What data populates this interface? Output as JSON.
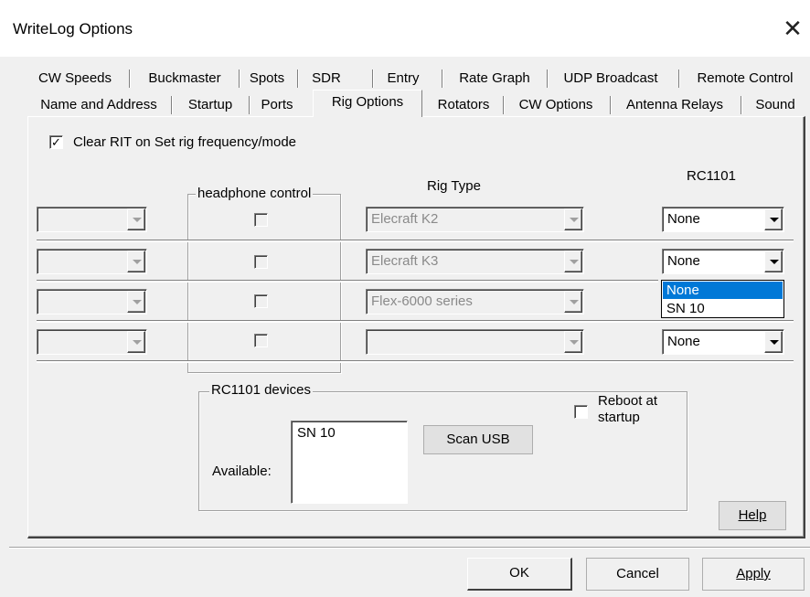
{
  "window": {
    "title": "WriteLog Options",
    "close_glyph": "✕"
  },
  "tabs_row1": [
    "CW Speeds",
    "Buckmaster",
    "Spots",
    "SDR",
    "Entry",
    "Rate Graph",
    "UDP Broadcast",
    "Remote Control"
  ],
  "tabs_row2": [
    "Name and Address",
    "Startup",
    "Ports",
    "Rig Options",
    "Rotators",
    "CW Options",
    "Antenna Relays",
    "Sound"
  ],
  "active_tab": "Rig Options",
  "clear_rit": {
    "label": "Clear RIT on Set rig frequency/mode",
    "checked": true,
    "check_glyph": "✓"
  },
  "headphone_group_title": "headphone control",
  "rig_type_header": "Rig Type",
  "rc1101_header": "RC1101",
  "rigs": [
    {
      "rig_type": "Elecraft K2",
      "rc1101": "None"
    },
    {
      "rig_type": "Elecraft K3",
      "rc1101": "None"
    },
    {
      "rig_type": "Flex-6000 series",
      "rc1101": ""
    },
    {
      "rig_type": "",
      "rc1101": "None"
    }
  ],
  "rc1101_dropdown": {
    "open_on_row": 2,
    "options": [
      "None",
      "SN 10"
    ],
    "highlighted": "None"
  },
  "devices_group": {
    "title": "RC1101 devices",
    "available_label": "Available:",
    "available_items": [
      "SN 10"
    ],
    "scan_button": "Scan USB",
    "reboot_label_line1": "Reboot at",
    "reboot_label_line2": "startup",
    "reboot_checked": false
  },
  "help_button": "Help",
  "footer_buttons": {
    "ok": "OK",
    "cancel": "Cancel",
    "apply": "Apply"
  },
  "colors": {
    "selection": "#0078d7",
    "dialog_bg": "#f0f0f0"
  }
}
